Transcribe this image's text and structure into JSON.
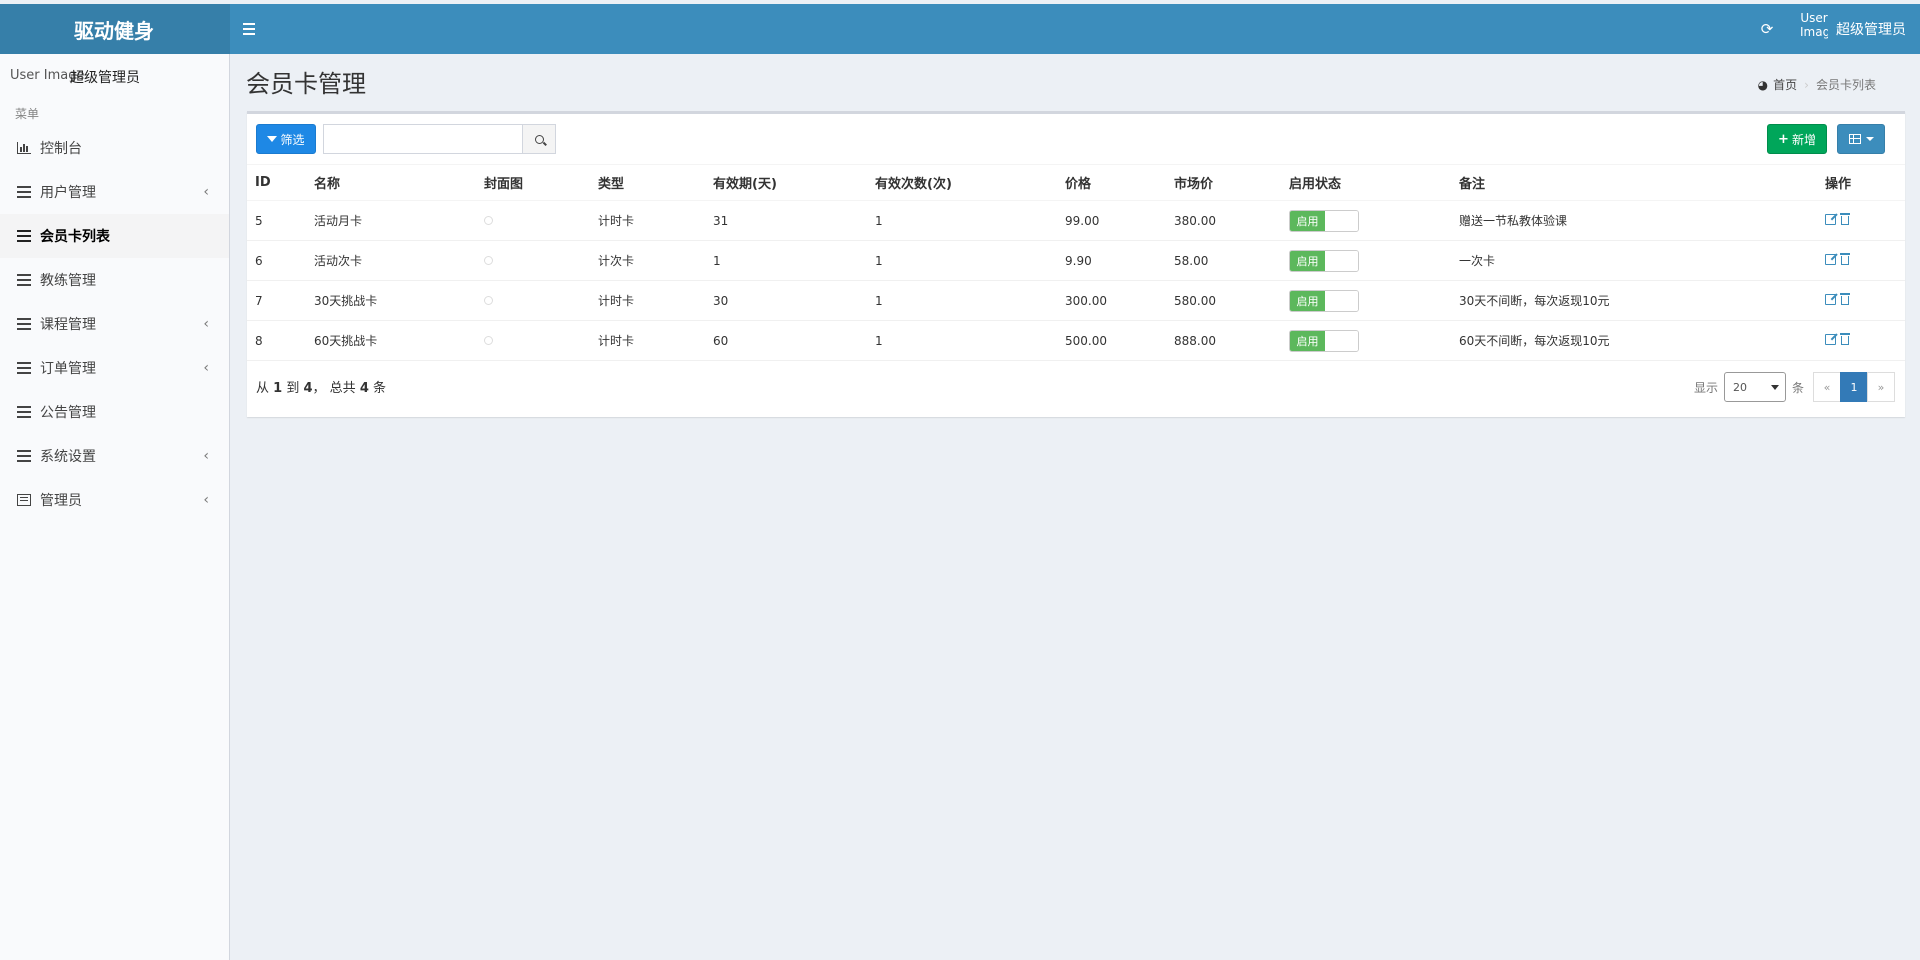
{
  "app": {
    "logo": "驱动健身",
    "user_image_alt": "User Image",
    "user_name": "超级管理员"
  },
  "sidebar": {
    "user_image_alt": "User Image",
    "user_name": "超级管理员",
    "header": "菜单",
    "items": [
      {
        "label": "控制台",
        "icon": "bar-chart-icon",
        "has_children": false,
        "active": false
      },
      {
        "label": "用户管理",
        "icon": "list-icon",
        "has_children": true,
        "active": false
      },
      {
        "label": "会员卡列表",
        "icon": "list-icon",
        "has_children": false,
        "active": true
      },
      {
        "label": "教练管理",
        "icon": "list-icon",
        "has_children": false,
        "active": false
      },
      {
        "label": "课程管理",
        "icon": "list-icon",
        "has_children": true,
        "active": false
      },
      {
        "label": "订单管理",
        "icon": "list-icon",
        "has_children": true,
        "active": false
      },
      {
        "label": "公告管理",
        "icon": "list-icon",
        "has_children": false,
        "active": false
      },
      {
        "label": "系统设置",
        "icon": "list-icon",
        "has_children": true,
        "active": false
      },
      {
        "label": "管理员",
        "icon": "admin-list-icon",
        "has_children": true,
        "active": false
      }
    ]
  },
  "page": {
    "title": "会员卡管理",
    "breadcrumb": {
      "home": "首页",
      "current": "会员卡列表"
    }
  },
  "toolbar": {
    "filter_label": "筛选",
    "search_placeholder": "",
    "add_label": "新增"
  },
  "table": {
    "columns": [
      "ID",
      "名称",
      "封面图",
      "类型",
      "有效期(天)",
      "有效次数(次)",
      "价格",
      "市场价",
      "启用状态",
      "备注",
      "操作"
    ],
    "rows": [
      {
        "id": "5",
        "name": "活动月卡",
        "type": "计时卡",
        "days": "31",
        "times": "1",
        "price": "99.00",
        "market": "380.00",
        "status": "启用",
        "remark": "赠送一节私教体验课"
      },
      {
        "id": "6",
        "name": "活动次卡",
        "type": "计次卡",
        "days": "1",
        "times": "1",
        "price": "9.90",
        "market": "58.00",
        "status": "启用",
        "remark": "一次卡"
      },
      {
        "id": "7",
        "name": "30天挑战卡",
        "type": "计时卡",
        "days": "30",
        "times": "1",
        "price": "300.00",
        "market": "580.00",
        "status": "启用",
        "remark": "30天不间断，每次返现10元"
      },
      {
        "id": "8",
        "name": "60天挑战卡",
        "type": "计时卡",
        "days": "60",
        "times": "1",
        "price": "500.00",
        "market": "888.00",
        "status": "启用",
        "remark": "60天不间断，每次返现10元"
      }
    ]
  },
  "footer": {
    "prefix": "从",
    "from": "1",
    "to_word": "到",
    "to": "4",
    "total_word": "， 总共",
    "total": "4",
    "suffix": "条",
    "show_label": "显示",
    "page_size": "20",
    "unit": "条",
    "prev": "«",
    "current_page": "1",
    "next": "»"
  },
  "colors": {
    "header": "#3c8dbc",
    "logo_bg": "#367fa9",
    "filter_btn": "#1e88e5",
    "add_btn": "#00a65a",
    "switch_on": "#5cb85c",
    "active_page": "#337ab7"
  }
}
